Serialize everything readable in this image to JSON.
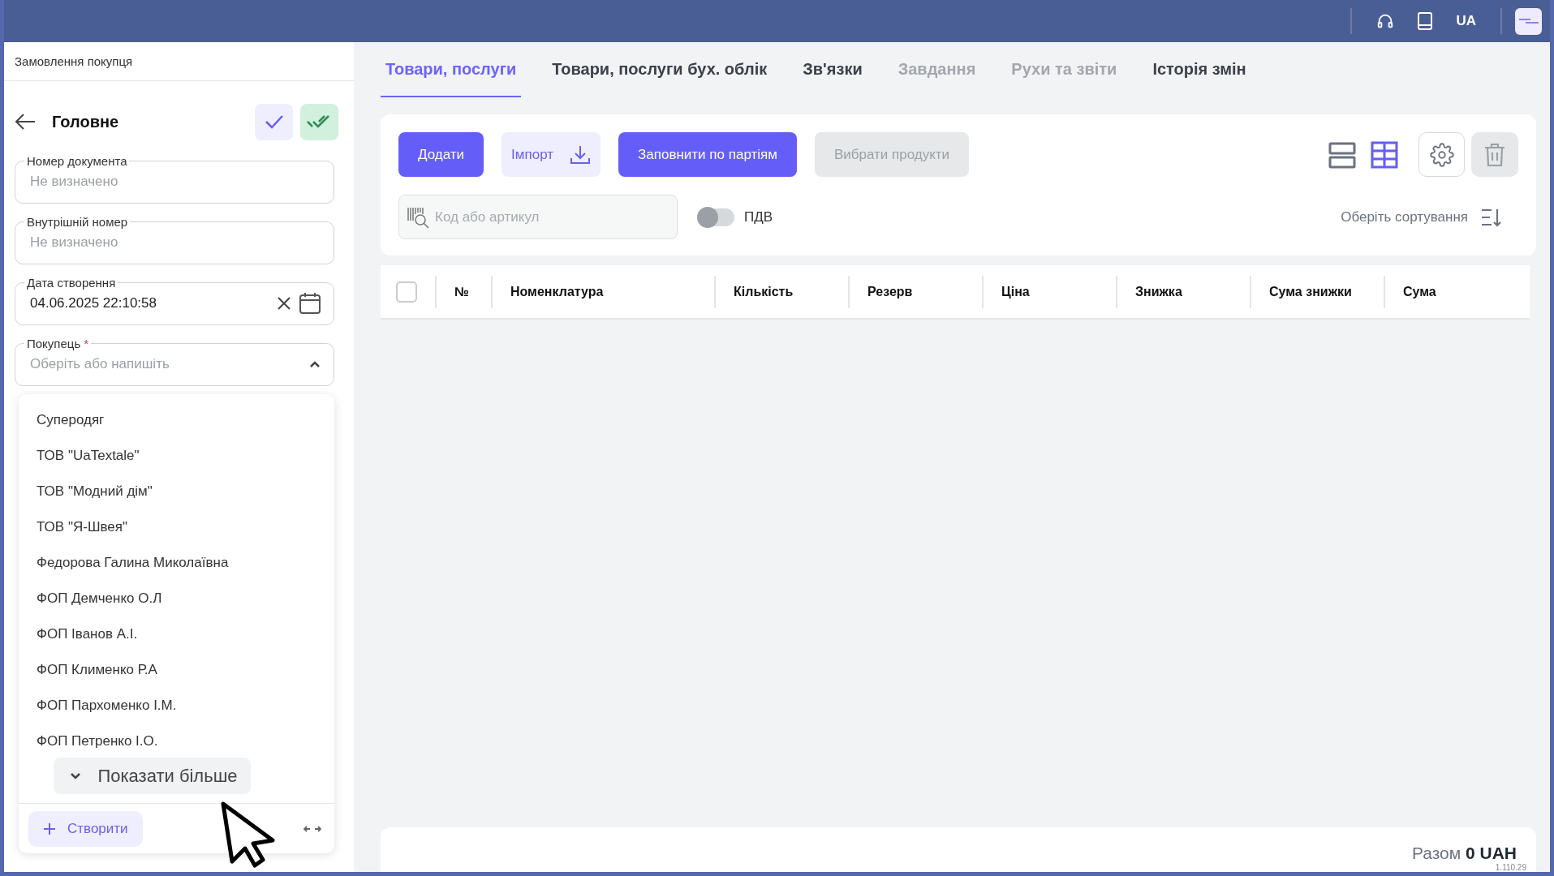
{
  "top_bar": {
    "language": "UA"
  },
  "left_panel": {
    "breadcrumb": "Замовлення покупця",
    "title": "Головне",
    "fields": [
      {
        "kind": "text",
        "label": "Номер документа",
        "placeholder": "Не визначено"
      },
      {
        "kind": "text",
        "label": "Внутрішній номер",
        "placeholder": "Не визначено"
      },
      {
        "kind": "date",
        "label": "Дата створення",
        "value": "04.06.2025 22:10:58"
      },
      {
        "kind": "select",
        "label": "Покупець",
        "required_mark": "*",
        "placeholder": "Оберіть або напишіть",
        "expanded": true
      }
    ],
    "dropdown": {
      "options": [
        "Суперодяг",
        "ТОВ \"UaTextale\"",
        "ТОВ \"Модний дім\"",
        "ТОВ \"Я-Швея\"",
        "Федорова Галина Миколаївна",
        "ФОП Демченко О.Л",
        "ФОП Іванов А.І.",
        "ФОП Клименко Р.А",
        "ФОП Пархоменко І.М.",
        "ФОП Петренко І.О."
      ],
      "show_more": "Показати більше",
      "create": "Створити"
    }
  },
  "tabs": [
    {
      "label": "Товари, послуги",
      "selected": true,
      "disabled": false
    },
    {
      "label": "Товари, послуги бух. облік",
      "selected": false,
      "disabled": false
    },
    {
      "label": "Зв'язки",
      "selected": false,
      "disabled": false
    },
    {
      "label": "Завдання",
      "selected": false,
      "disabled": true
    },
    {
      "label": "Рухи та звіти",
      "selected": false,
      "disabled": true
    },
    {
      "label": "Історія змін",
      "selected": false,
      "disabled": false
    }
  ],
  "toolbar": {
    "buttons": [
      {
        "label": "Додати",
        "kind": "primary",
        "disabled": false
      },
      {
        "label": "Імпорт",
        "kind": "import",
        "disabled": false
      },
      {
        "label": "Заповнити по партіям",
        "kind": "primary",
        "disabled": false
      },
      {
        "label": "Вибрати продукти",
        "kind": "primary",
        "disabled": true
      }
    ],
    "views": [
      {
        "kind": "rows",
        "selected": false
      },
      {
        "kind": "grid",
        "selected": true
      }
    ],
    "delete_disabled": true,
    "search": {
      "placeholder": "Код або артикул"
    },
    "vat": {
      "label": "ПДВ",
      "on": false
    },
    "sort": {
      "label": "Оберіть сортування"
    }
  },
  "table": {
    "select_all_checked": false,
    "columns": [
      "№",
      "Номенклатура",
      "Кількість",
      "Резерв",
      "Ціна",
      "Знижка",
      "Сума знижки",
      "Сума"
    ]
  },
  "footer": {
    "total": "Разом **0 UAH**",
    "version": "1.110.29"
  }
}
